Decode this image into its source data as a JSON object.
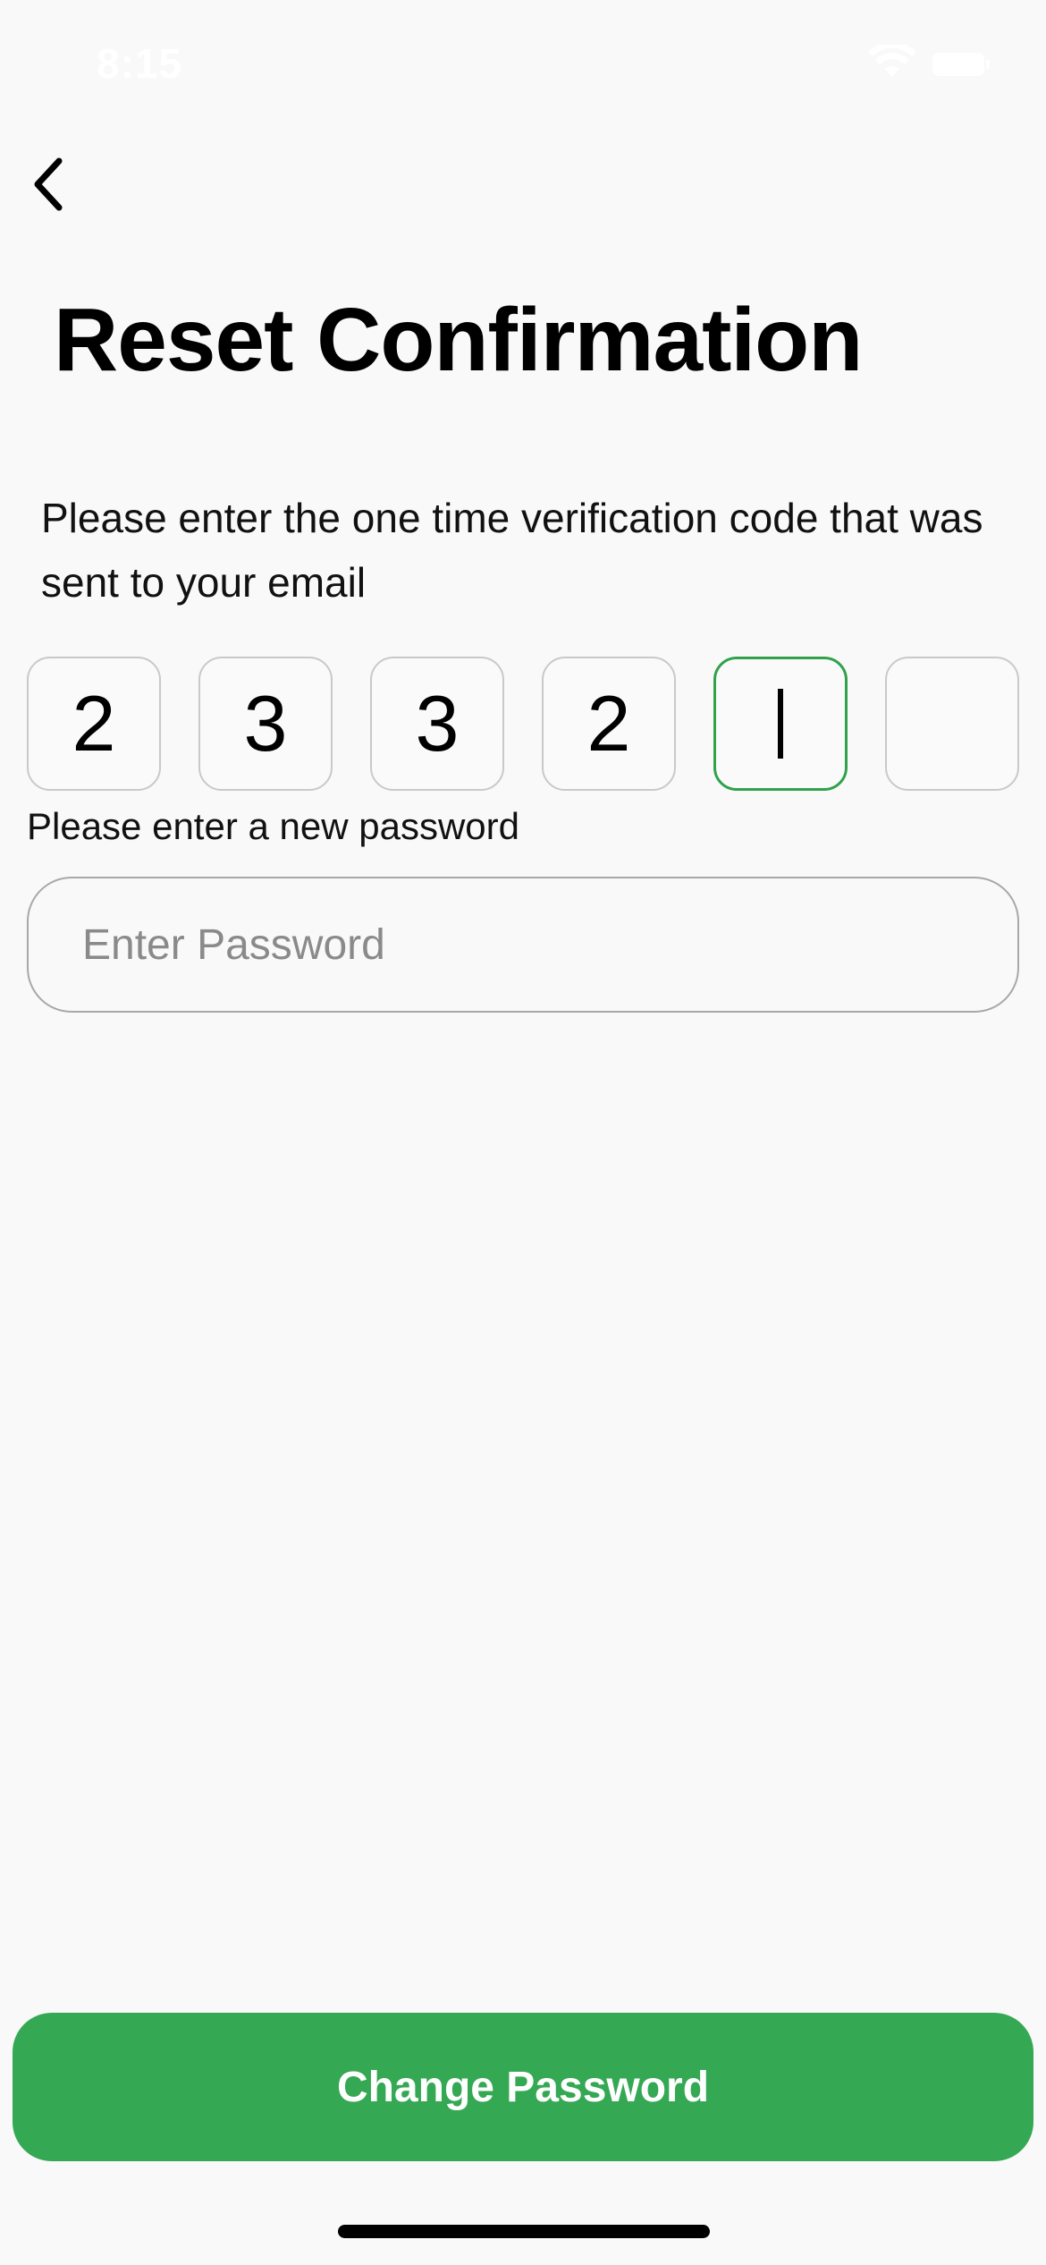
{
  "status_bar": {
    "time": "8:15",
    "icons": [
      "wifi-icon",
      "battery-icon"
    ]
  },
  "nav": {
    "back_icon": "chevron-left-icon"
  },
  "title": "Reset Confirmation",
  "instructions": "Please enter the one time verification code that was sent to your email",
  "otp": {
    "digits": [
      "2",
      "3",
      "3",
      "2",
      "",
      ""
    ],
    "active_index": 4,
    "active_color": "#30a24a"
  },
  "password": {
    "label": "Please enter a new password",
    "placeholder": "Enter Password",
    "value": ""
  },
  "primary_button": {
    "label": "Change Password",
    "color": "#35a853"
  }
}
